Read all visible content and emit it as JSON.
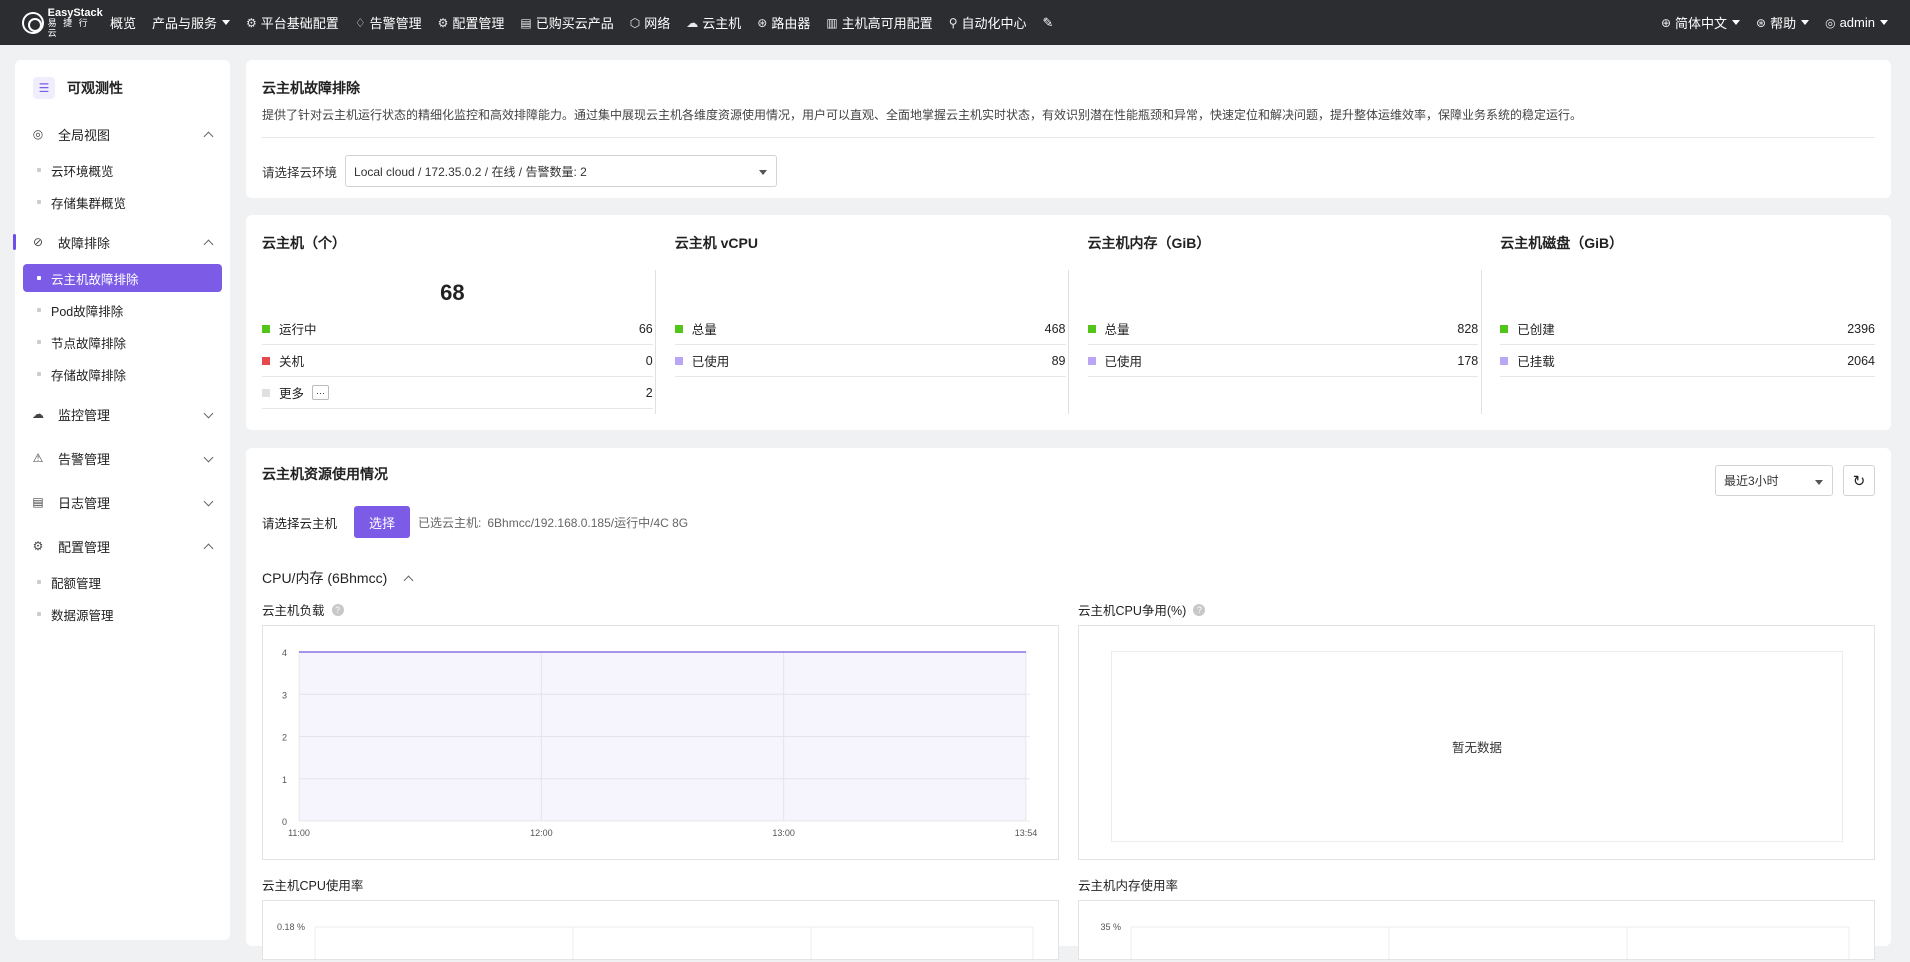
{
  "app": {
    "logo_line1": "EasyStack",
    "logo_line2": "易 捷 行 云"
  },
  "topnav": [
    {
      "label": "概览",
      "icon": "",
      "caret": false
    },
    {
      "label": "产品与服务",
      "icon": "",
      "caret": true
    },
    {
      "label": "平台基础配置",
      "icon": "settings-icon",
      "caret": false
    },
    {
      "label": "告警管理",
      "icon": "bell-icon",
      "caret": false
    },
    {
      "label": "配置管理",
      "icon": "gear-icon",
      "caret": false
    },
    {
      "label": "已购买云产品",
      "icon": "list-icon",
      "caret": false
    },
    {
      "label": "网络",
      "icon": "network-icon",
      "caret": false
    },
    {
      "label": "云主机",
      "icon": "cloud-icon",
      "caret": false
    },
    {
      "label": "路由器",
      "icon": "router-icon",
      "caret": false
    },
    {
      "label": "主机高可用配置",
      "icon": "ha-icon",
      "caret": false
    },
    {
      "label": "自动化中心",
      "icon": "automation-icon",
      "caret": false
    }
  ],
  "rightnav": {
    "language": "简体中文",
    "help": "帮助",
    "user": "admin"
  },
  "sidebar": {
    "title": "可观测性",
    "groups": [
      {
        "label": "全局视图",
        "icon": "globe-icon",
        "expanded": true,
        "items": [
          "云环境概览",
          "存储集群概览"
        ]
      },
      {
        "label": "故障排除",
        "icon": "troubleshoot-icon",
        "expanded": true,
        "items": [
          "云主机故障排除",
          "Pod故障排除",
          "节点故障排除",
          "存储故障排除"
        ]
      },
      {
        "label": "监控管理",
        "icon": "monitor-icon",
        "expanded": false,
        "items": []
      },
      {
        "label": "告警管理",
        "icon": "alarm-icon",
        "expanded": false,
        "items": []
      },
      {
        "label": "日志管理",
        "icon": "log-icon",
        "expanded": false,
        "items": []
      },
      {
        "label": "配置管理",
        "icon": "config-icon",
        "expanded": true,
        "items": [
          "配额管理",
          "数据源管理"
        ]
      }
    ],
    "active_item": "云主机故障排除"
  },
  "header": {
    "title": "云主机故障排除",
    "description": "提供了针对云主机运行状态的精细化监控和高效排障能力。通过集中展现云主机各维度资源使用情况，用户可以直观、全面地掌握云主机实时状态，有效识别潜在性能瓶颈和异常，快速定位和解决问题，提升整体运维效率，保障业务系统的稳定运行。",
    "env_label": "请选择云环境",
    "env_value": "Local cloud / 172.35.0.2 / 在线 / 告警数量: 2"
  },
  "stats": {
    "vm": {
      "title": "云主机（个）",
      "total": "68",
      "rows": [
        {
          "label": "运行中",
          "value": "66",
          "color": "#52c41a"
        },
        {
          "label": "关机",
          "value": "0",
          "color": "#e5484d"
        },
        {
          "label": "更多",
          "value": "2",
          "color": "#e0e0e0"
        }
      ],
      "more_btn": "···"
    },
    "vcpu": {
      "title": "云主机 vCPU",
      "rows": [
        {
          "label": "总量",
          "value": "468",
          "color": "#52c41a"
        },
        {
          "label": "已使用",
          "value": "89",
          "color": "#b9a6f5"
        }
      ]
    },
    "mem": {
      "title": "云主机内存（GiB）",
      "rows": [
        {
          "label": "总量",
          "value": "828",
          "color": "#52c41a"
        },
        {
          "label": "已使用",
          "value": "178",
          "color": "#b9a6f5"
        }
      ]
    },
    "disk": {
      "title": "云主机磁盘（GiB）",
      "rows": [
        {
          "label": "已创建",
          "value": "2396",
          "color": "#52c41a"
        },
        {
          "label": "已挂载",
          "value": "2064",
          "color": "#b9a6f5"
        }
      ]
    }
  },
  "usage": {
    "title": "云主机资源使用情况",
    "time_range": "最近3小时",
    "vm_label": "请选择云主机",
    "select_btn": "选择",
    "selected_prefix": "已选云主机:",
    "selected_value": "6Bhmcc/192.168.0.185/运行中/4C 8G",
    "section_title": "CPU/内存 (6Bhmcc)",
    "no_data": "暂无数据"
  },
  "chart_data": [
    {
      "type": "area",
      "title": "云主机负载",
      "x": [
        "11:00",
        "12:00",
        "13:00",
        "13:54"
      ],
      "ylim": [
        0,
        4
      ],
      "yticks": [
        "0",
        "1",
        "2",
        "3",
        "4"
      ],
      "series": [
        {
          "values": [
            4,
            4,
            4,
            4
          ]
        }
      ],
      "color": "#8a72e6"
    },
    {
      "type": "line",
      "title": "云主机CPU争用(%)",
      "series": []
    },
    {
      "type": "line",
      "title": "云主机CPU使用率",
      "yticks": [
        "0.18 %"
      ]
    },
    {
      "type": "line",
      "title": "云主机内存使用率",
      "yticks": [
        "35 %"
      ]
    }
  ]
}
